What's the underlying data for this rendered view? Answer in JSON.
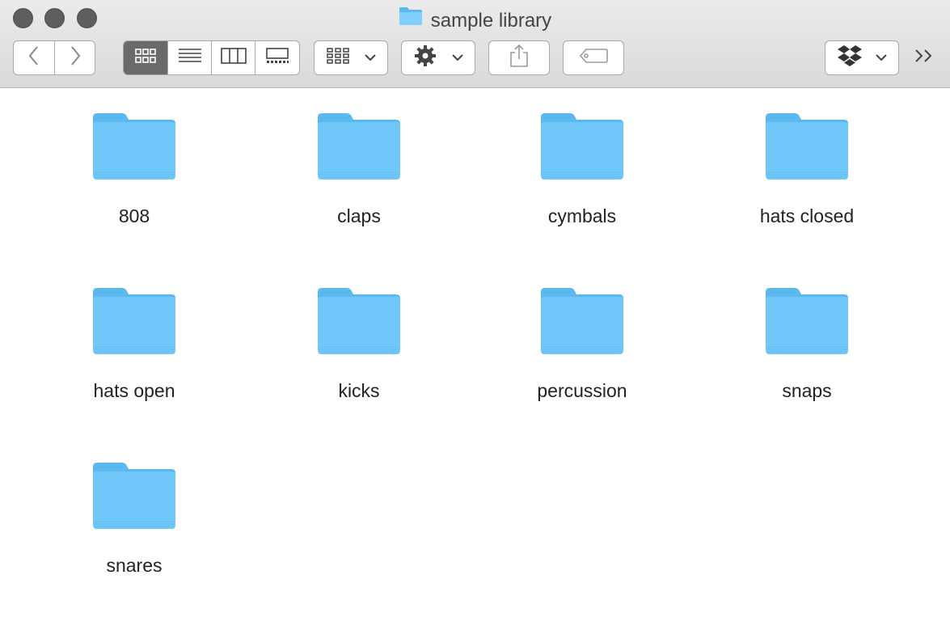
{
  "window": {
    "title": "sample library"
  },
  "toolbar": {
    "overflow_label": ">>"
  },
  "folders": [
    {
      "name": "808"
    },
    {
      "name": "claps"
    },
    {
      "name": "cymbals"
    },
    {
      "name": "hats closed"
    },
    {
      "name": "hats open"
    },
    {
      "name": "kicks"
    },
    {
      "name": "percussion"
    },
    {
      "name": "snaps"
    },
    {
      "name": "snares"
    }
  ],
  "colors": {
    "folder_body": "#6fc8f9",
    "folder_tab": "#5bb9ef",
    "selected_view": "#6a6a6a"
  }
}
